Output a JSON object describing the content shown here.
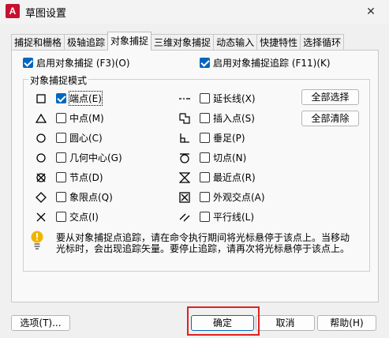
{
  "window": {
    "app_icon_letter": "A",
    "title": "草图设置",
    "close_glyph": "✕"
  },
  "tabs": [
    {
      "label": "捕捉和栅格",
      "active": false
    },
    {
      "label": "极轴追踪",
      "active": false
    },
    {
      "label": "对象捕捉",
      "active": true
    },
    {
      "label": "三维对象捕捉",
      "active": false
    },
    {
      "label": "动态输入",
      "active": false
    },
    {
      "label": "快捷特性",
      "active": false
    },
    {
      "label": "选择循环",
      "active": false
    }
  ],
  "options": {
    "enable_osnap": {
      "label": "启用对象捕捉 (F3)(O)",
      "checked": true
    },
    "enable_tracking": {
      "label": "启用对象捕捉追踪 (F11)(K)",
      "checked": true
    }
  },
  "modes": {
    "group_title": "对象捕捉模式",
    "left": [
      {
        "label": "端点(E)",
        "checked": true,
        "icon": "square-icon"
      },
      {
        "label": "中点(M)",
        "checked": false,
        "icon": "triangle-icon"
      },
      {
        "label": "圆心(C)",
        "checked": false,
        "icon": "circle-icon"
      },
      {
        "label": "几何中心(G)",
        "checked": false,
        "icon": "circle-icon"
      },
      {
        "label": "节点(D)",
        "checked": false,
        "icon": "circle-cross-icon"
      },
      {
        "label": "象限点(Q)",
        "checked": false,
        "icon": "diamond-icon"
      },
      {
        "label": "交点(I)",
        "checked": false,
        "icon": "x-cross-icon"
      }
    ],
    "right": [
      {
        "label": "延长线(X)",
        "checked": false,
        "icon": "dashed-line-icon"
      },
      {
        "label": "插入点(S)",
        "checked": false,
        "icon": "insert-icon"
      },
      {
        "label": "垂足(P)",
        "checked": false,
        "icon": "perpendicular-icon"
      },
      {
        "label": "切点(N)",
        "checked": false,
        "icon": "tangent-icon"
      },
      {
        "label": "最近点(R)",
        "checked": false,
        "icon": "hourglass-icon"
      },
      {
        "label": "外观交点(A)",
        "checked": false,
        "icon": "box-x-icon"
      },
      {
        "label": "平行线(L)",
        "checked": false,
        "icon": "parallel-icon"
      }
    ],
    "select_all": "全部选择",
    "clear_all": "全部清除"
  },
  "info": {
    "text": "要从对象捕捉点追踪，请在命令执行期间将光标悬停于该点上。当移动光标时，会出现追踪矢量。要停止追踪，请再次将光标悬停于该点上。",
    "icon_color": "#f0b400"
  },
  "footer": {
    "options": "选项(T)...",
    "ok": "确定",
    "cancel": "取消",
    "help": "帮助(H)"
  },
  "colors": {
    "accent": "#0067c0",
    "highlight": "#e02020"
  }
}
